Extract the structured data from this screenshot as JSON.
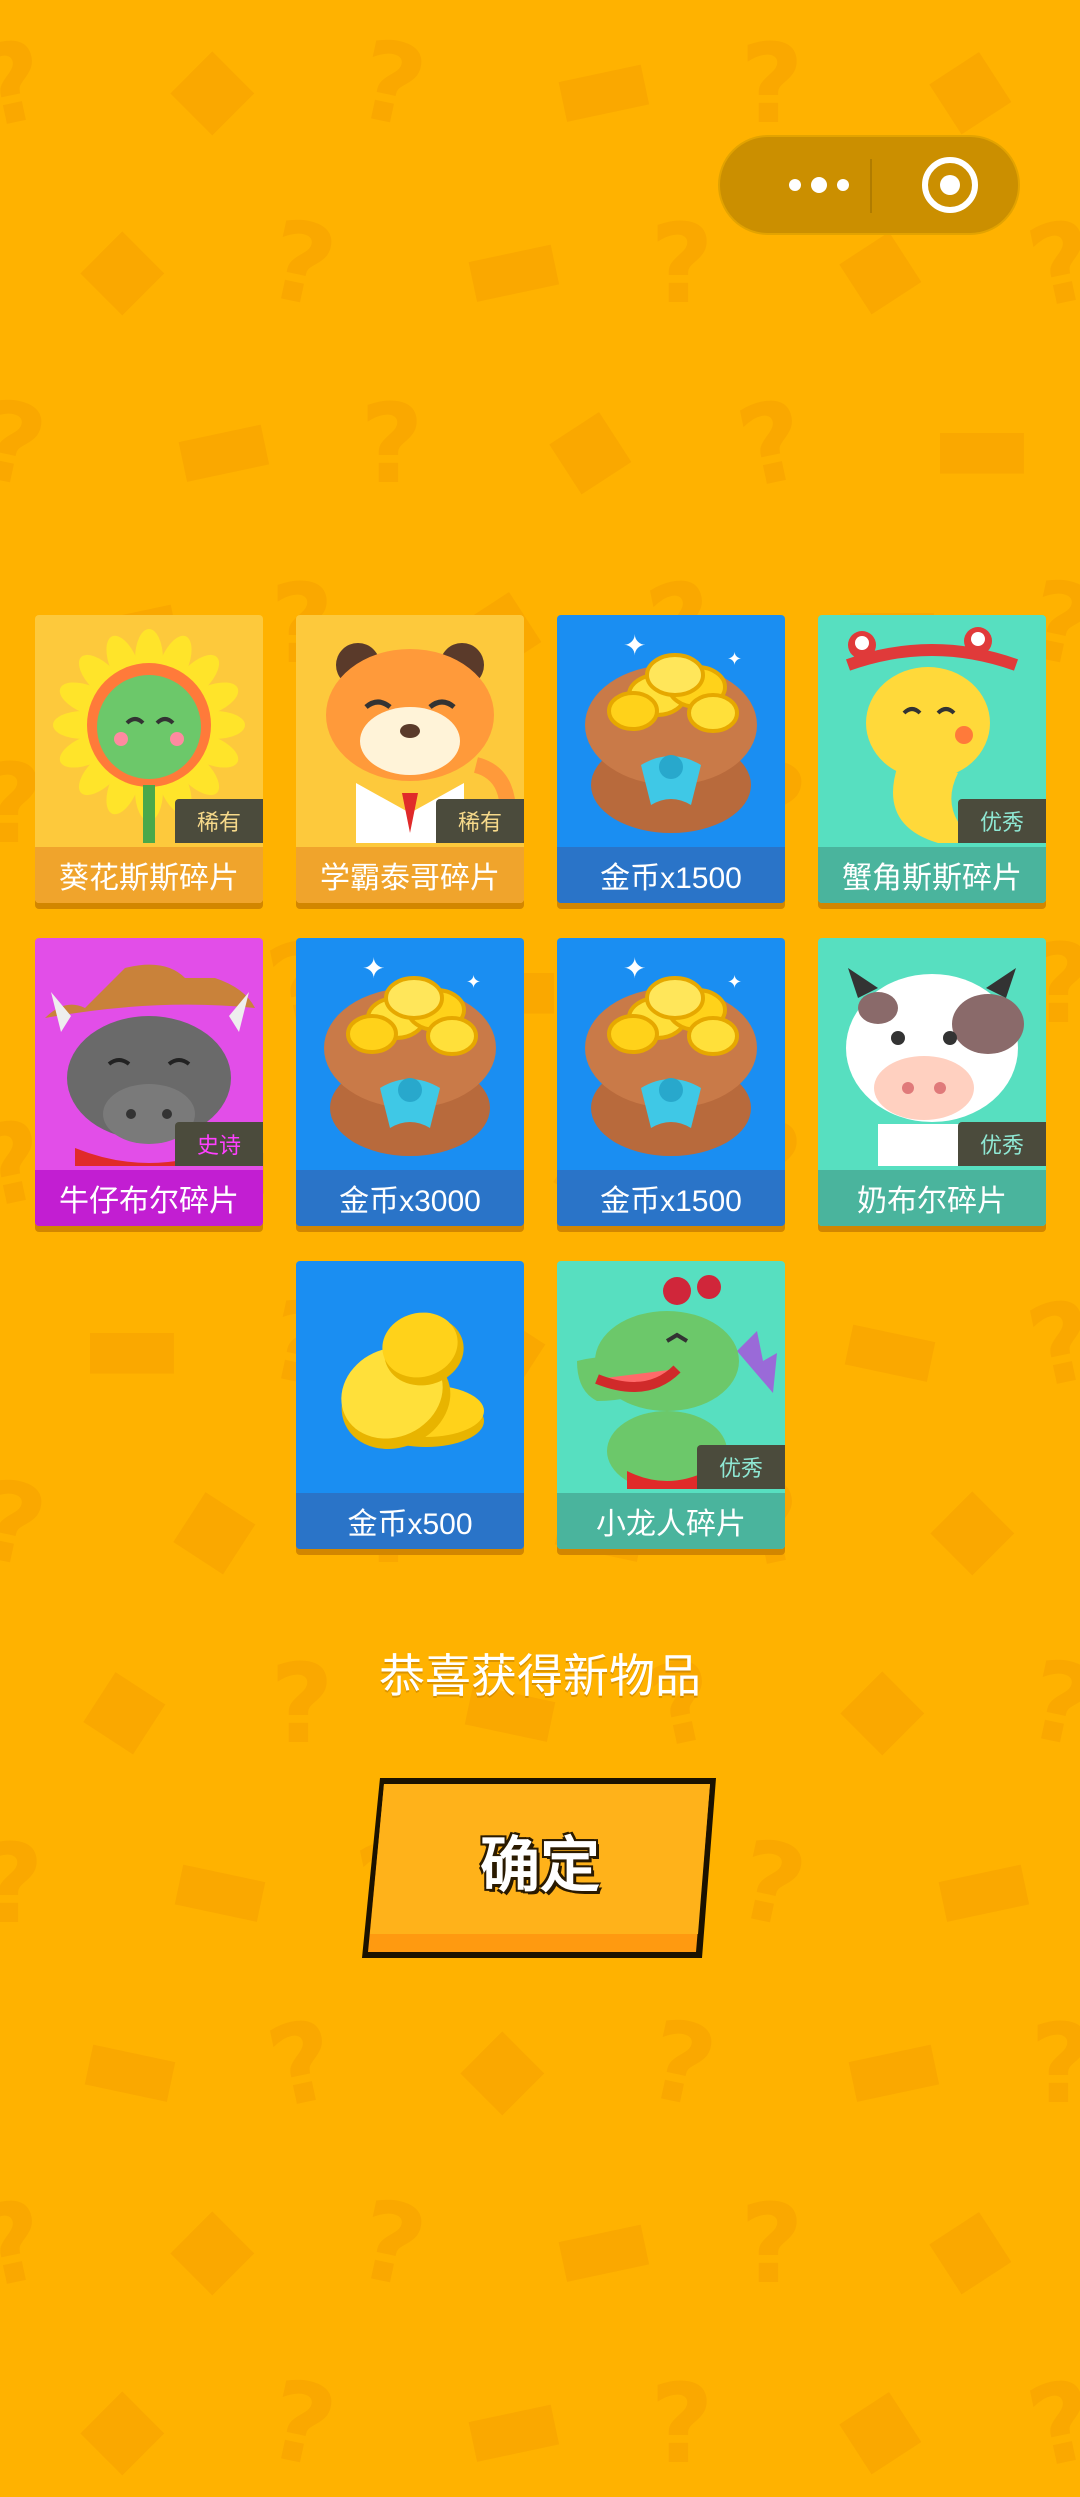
{
  "capsule": {
    "menu_icon": "more-dots-icon",
    "close_icon": "target-circle-icon"
  },
  "items": [
    {
      "name": "葵花斯斯碎片",
      "tag": "稀有",
      "bg": "#fdc93c",
      "label_bg": "#f0a42c",
      "tag_color": "#f6d98a",
      "art": "sunflower"
    },
    {
      "name": "学霸泰哥碎片",
      "tag": "稀有",
      "bg": "#fdc93c",
      "label_bg": "#f0a42c",
      "tag_color": "#f6d98a",
      "art": "tiger"
    },
    {
      "name": "金币x1500",
      "tag": "",
      "bg": "#1a8ef2",
      "label_bg": "#2a74c8",
      "tag_color": "",
      "art": "coin-bag"
    },
    {
      "name": "蟹角斯斯碎片",
      "tag": "优秀",
      "bg": "#57dfc0",
      "label_bg": "#4ab49d",
      "tag_color": "#8fe8d4",
      "art": "crab-snake"
    },
    {
      "name": "牛仔布尔碎片",
      "tag": "史诗",
      "bg": "#e24ee8",
      "label_bg": "#c21ed2",
      "tag_color": "#ff40ff",
      "art": "cowboy-bull"
    },
    {
      "name": "金币x3000",
      "tag": "",
      "bg": "#1a8ef2",
      "label_bg": "#2a74c8",
      "tag_color": "",
      "art": "coin-bag"
    },
    {
      "name": "金币x1500",
      "tag": "",
      "bg": "#1a8ef2",
      "label_bg": "#2a74c8",
      "tag_color": "",
      "art": "coin-bag"
    },
    {
      "name": "奶布尔碎片",
      "tag": "优秀",
      "bg": "#57dfc0",
      "label_bg": "#4ab49d",
      "tag_color": "#8fe8d4",
      "art": "cow"
    },
    {
      "name": "金币x500",
      "tag": "",
      "bg": "#1a8ef2",
      "label_bg": "#2a74c8",
      "tag_color": "",
      "art": "coins"
    },
    {
      "name": "小龙人碎片",
      "tag": "优秀",
      "bg": "#57dfc0",
      "label_bg": "#4ab49d",
      "tag_color": "#8fe8d4",
      "art": "dragon"
    }
  ],
  "message": "恭喜获得新物品",
  "confirm_label": "确定"
}
